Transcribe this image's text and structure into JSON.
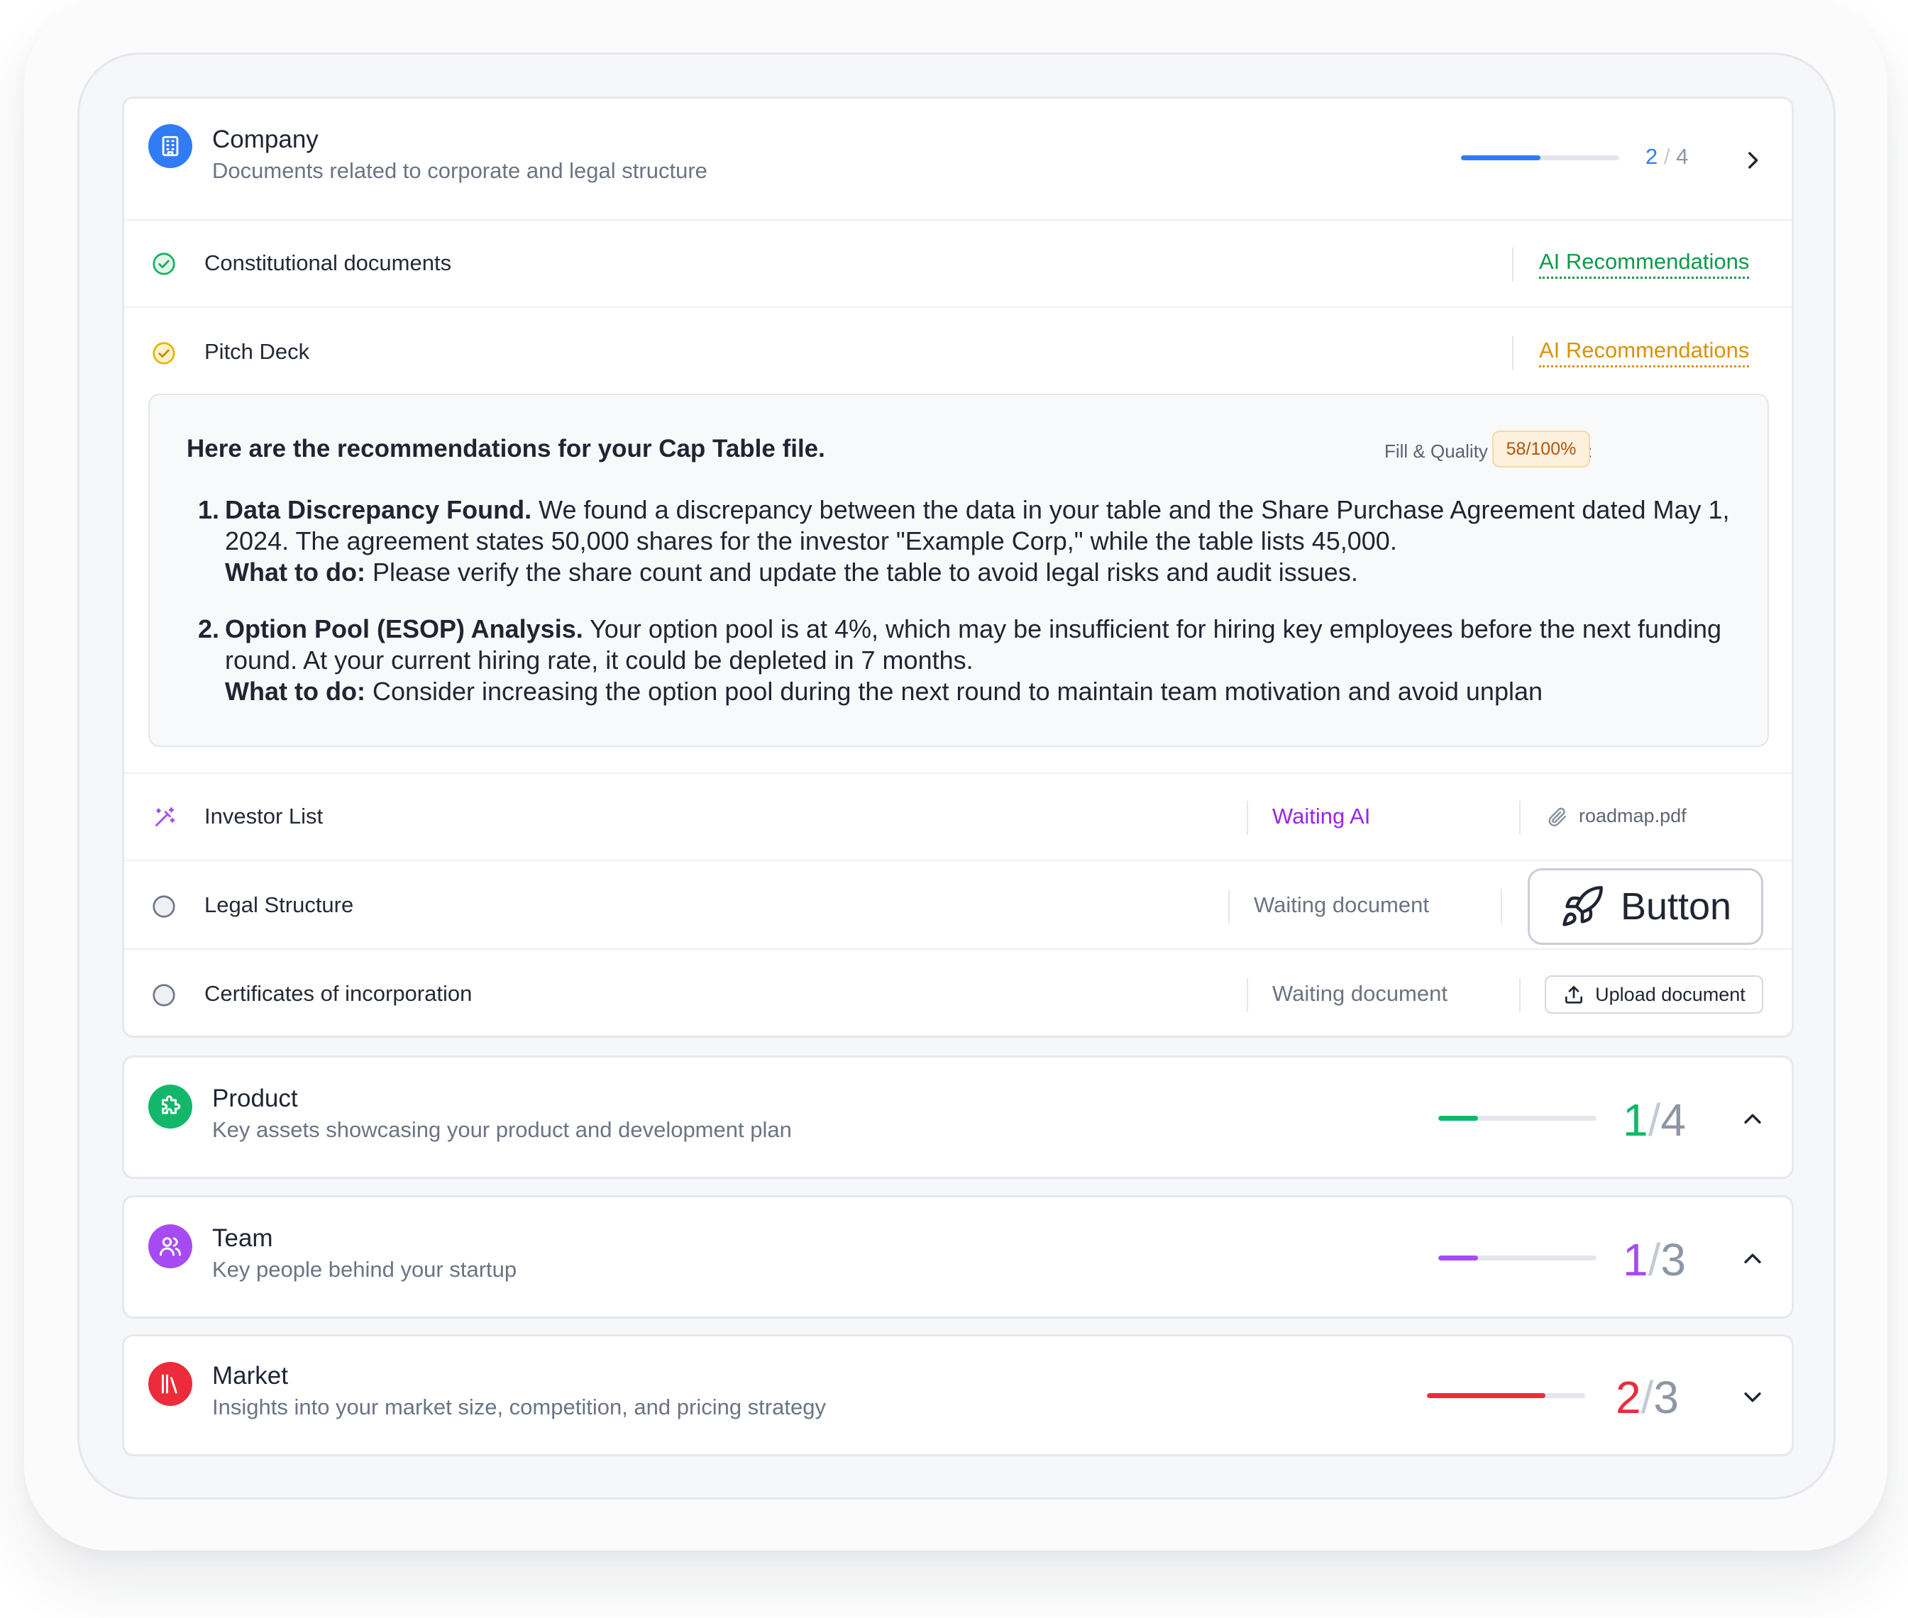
{
  "categories": {
    "company": {
      "title": "Company",
      "subtitle": "Documents related to corporate and legal structure",
      "done": "2",
      "total": "4",
      "progress": 0.5,
      "color": "#2f7cf6",
      "icon": "building-icon",
      "expanded": true
    },
    "product": {
      "title": "Product",
      "subtitle": "Key assets showcasing your product and development plan",
      "done": "1",
      "total": "4",
      "progress": 0.25,
      "color": "#12b86a",
      "icon": "puzzle-icon",
      "chevron": "chevron-up-icon"
    },
    "team": {
      "title": "Team",
      "subtitle": "Key people behind your startup",
      "done": "1",
      "total": "3",
      "progress": 0.25,
      "color": "#a64bf4",
      "icon": "users-icon",
      "chevron": "chevron-up-icon"
    },
    "market": {
      "title": "Market",
      "subtitle": "Insights into your market size, competition, and pricing strategy",
      "done": "2",
      "total": "3",
      "progress": 0.75,
      "color": "#ec2b3b",
      "icon": "library-icon",
      "chevron": "chevron-down-icon"
    }
  },
  "documents": {
    "constitutional": {
      "label": "Constitutional documents",
      "action": "AI Recommendations",
      "color": "#0e9a48",
      "icon": "check-circle-icon"
    },
    "pitch_deck": {
      "label": "Pitch Deck",
      "action": "AI Recommendations",
      "color": "#d9920a",
      "icon": "check-circle-icon"
    },
    "investor_list": {
      "label": "Investor List",
      "status": "Waiting AI",
      "status_color": "#9b24e8",
      "attachment": "roadmap.pdf",
      "icon": "magic-wand-icon"
    },
    "legal_structure": {
      "label": "Legal Structure",
      "status": "Waiting document",
      "button": "Button",
      "icon": "empty-circle-icon"
    },
    "certificates": {
      "label": "Certificates of incorporation",
      "status": "Waiting document",
      "button": "Upload document",
      "icon": "empty-circle-icon"
    }
  },
  "recommendations": {
    "title": "Here are the recommendations for your Cap Table file.",
    "fill_label": "Fill & Quality Percentage:",
    "fill_value": "58/100%",
    "items": [
      {
        "num": "1.",
        "heading": "Data Discrepancy Found.",
        "body": "We found a discrepancy between the data in your table and the Share Purchase Agreement dated May 1, 2024. The agreement states 50,000 shares for the investor \"Example Corp,\" while the table lists 45,000.",
        "todo_label": "What to do:",
        "todo": "Please verify the share count and update the table to avoid legal risks and audit issues."
      },
      {
        "num": "2.",
        "heading": "Option Pool (ESOP) Analysis.",
        "body": "Your option pool is at 4%, which may be insufficient for hiring key employees before the next funding round. At your current hiring rate, it could be depleted in 7 months.",
        "todo_label": "What to do:",
        "todo": "Consider increasing the option pool during the next round to maintain team motivation and avoid unplan"
      }
    ]
  }
}
